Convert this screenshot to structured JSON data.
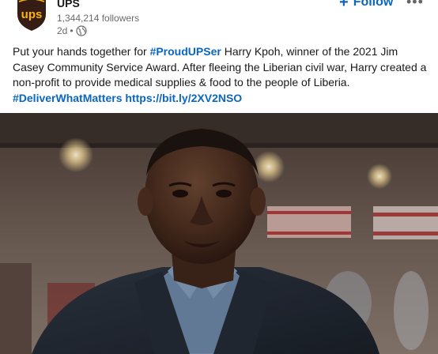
{
  "company": {
    "name": "UPS",
    "followers": "1,344,214 followers",
    "time": "2d",
    "logo_text": "ups"
  },
  "actions": {
    "follow_label": "Follow",
    "follow_icon": "plus-icon",
    "more_icon": "more-icon",
    "more_glyph": "•••"
  },
  "post": {
    "text_1": "Put your hands together for ",
    "hashtag_1": "#ProudUPSer",
    "text_2": " Harry Kpoh, winner of the 2021 Jim Casey Community Service Award. After fleeing the Liberian civil war, Harry created a non-profit to provide medical supplies & food to the people of Liberia.",
    "hashtag_2": "#DeliverWhatMatters",
    "link": "https://bit.ly/2XV2NSO"
  },
  "colors": {
    "link": "#0a66c2",
    "ups_brown": "#351c15",
    "ups_gold": "#ffb500"
  }
}
